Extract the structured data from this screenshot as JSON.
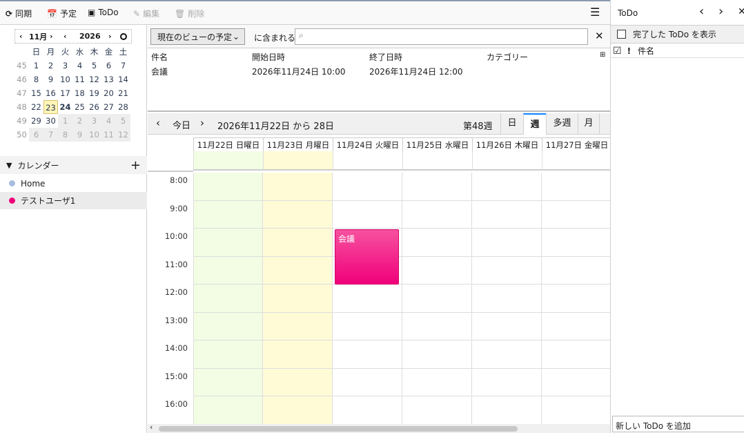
{
  "toolbar": {
    "sync": "同期",
    "event": "予定",
    "todo": "ToDo",
    "edit": "編集",
    "delete": "削除"
  },
  "minical": {
    "month": "11月",
    "year": "2026",
    "weekdays": [
      "日",
      "月",
      "火",
      "水",
      "木",
      "金",
      "土"
    ],
    "weeks": [
      {
        "wk": "45",
        "days": [
          "1",
          "2",
          "3",
          "4",
          "5",
          "6",
          "7"
        ]
      },
      {
        "wk": "46",
        "days": [
          "8",
          "9",
          "10",
          "11",
          "12",
          "13",
          "14"
        ]
      },
      {
        "wk": "47",
        "days": [
          "15",
          "16",
          "17",
          "18",
          "19",
          "20",
          "21"
        ]
      },
      {
        "wk": "48",
        "days": [
          "22",
          "23",
          "24",
          "25",
          "26",
          "27",
          "28"
        ]
      },
      {
        "wk": "49",
        "days": [
          "29",
          "30",
          "1",
          "2",
          "3",
          "4",
          "5"
        ]
      },
      {
        "wk": "50",
        "days": [
          "6",
          "7",
          "8",
          "9",
          "10",
          "11",
          "12"
        ]
      }
    ],
    "today": "23",
    "selected": "24"
  },
  "calendars": {
    "title": "カレンダー",
    "items": [
      {
        "name": "Home",
        "color": "#a6bde0"
      },
      {
        "name": "テストユーザ1",
        "color": "#f0007a"
      }
    ]
  },
  "filter": {
    "select": "現在のビューの予定",
    "contains": "に含まれる",
    "search_value": ""
  },
  "eventlist": {
    "columns": [
      "件名",
      "開始日時",
      "終了日時",
      "カテゴリー"
    ],
    "rows": [
      {
        "title": "会議",
        "start": "2026年11月24日 10:00",
        "end": "2026年11月24日 12:00",
        "category": ""
      }
    ]
  },
  "nav": {
    "today": "今日",
    "range": "2026年11月22日 から 28日",
    "week": "第48週",
    "views": [
      "日",
      "週",
      "多週",
      "月"
    ],
    "active_view": "週"
  },
  "week": {
    "days": [
      {
        "label": "11月22日 日曜日",
        "color": "#f2fde4"
      },
      {
        "label": "11月23日 月曜日",
        "color": "#fffbd6"
      },
      {
        "label": "11月24日 火曜日",
        "color": "#ffffff"
      },
      {
        "label": "11月25日 水曜日",
        "color": "#ffffff"
      },
      {
        "label": "11月26日 木曜日",
        "color": "#ffffff"
      },
      {
        "label": "11月27日 金曜日",
        "color": "#ffffff"
      }
    ],
    "hours": [
      "8:00",
      "9:00",
      "10:00",
      "11:00",
      "12:00",
      "13:00",
      "14:00",
      "15:00",
      "16:00"
    ],
    "events": [
      {
        "title": "会議",
        "day": 2,
        "start": 10,
        "end": 12,
        "color": "#f0007a"
      }
    ]
  },
  "todo": {
    "title": "ToDo",
    "show_completed": "完了した ToDo を表示",
    "col_title": "件名",
    "new_placeholder": "新しい ToDo を追加"
  }
}
